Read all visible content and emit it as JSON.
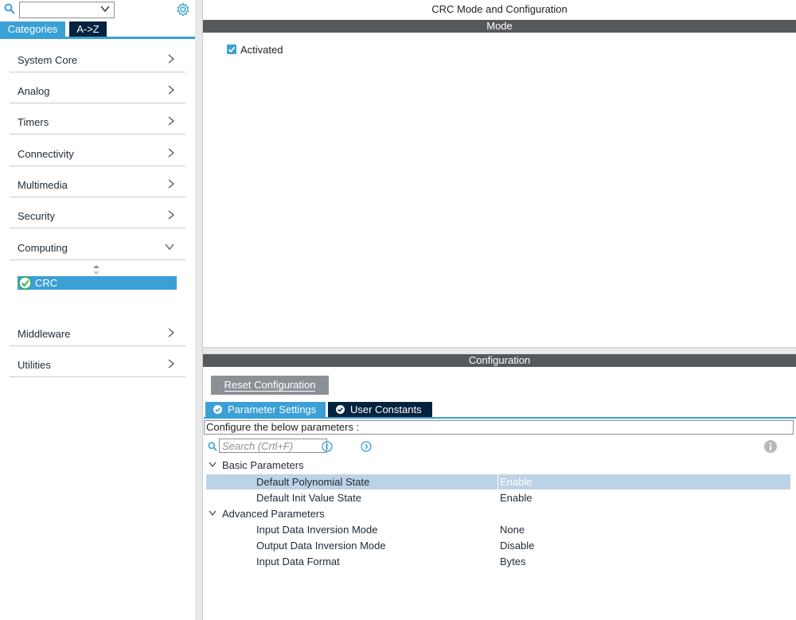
{
  "left_panel": {
    "search_placeholder": "",
    "tabs": {
      "categories": "Categories",
      "az": "A->Z"
    },
    "categories": [
      {
        "label": "System Core"
      },
      {
        "label": "Analog"
      },
      {
        "label": "Timers"
      },
      {
        "label": "Connectivity"
      },
      {
        "label": "Multimedia"
      },
      {
        "label": "Security"
      },
      {
        "label": "Computing"
      },
      {
        "label": "Middleware"
      },
      {
        "label": "Utilities"
      }
    ],
    "computing_items": [
      {
        "label": "CRC"
      }
    ]
  },
  "main": {
    "title": "CRC Mode and Configuration",
    "mode_header": "Mode",
    "activated_label": "Activated",
    "activated_checked": true,
    "config_header": "Configuration",
    "reset_button": "Reset Configuration",
    "tabs": {
      "parameter_settings": "Parameter Settings",
      "user_constants": "User Constants"
    },
    "description": "Configure the below parameters :",
    "param_search_placeholder": "Search (Crtl+F)",
    "groups": {
      "basic": {
        "label": "Basic Parameters",
        "params": [
          {
            "name": "Default Polynomial State",
            "value": "Enable"
          },
          {
            "name": "Default Init Value State",
            "value": "Enable"
          }
        ]
      },
      "advanced": {
        "label": "Advanced Parameters",
        "params": [
          {
            "name": "Input Data Inversion Mode",
            "value": "None"
          },
          {
            "name": "Output Data Inversion Mode",
            "value": "Disable"
          },
          {
            "name": "Input Data Format",
            "value": "Bytes"
          }
        ]
      }
    }
  },
  "colors": {
    "accent": "#3aa0d6",
    "dark_tab": "#04233f",
    "header_bar": "#55595e",
    "selected_row": "#bcd2e6"
  }
}
